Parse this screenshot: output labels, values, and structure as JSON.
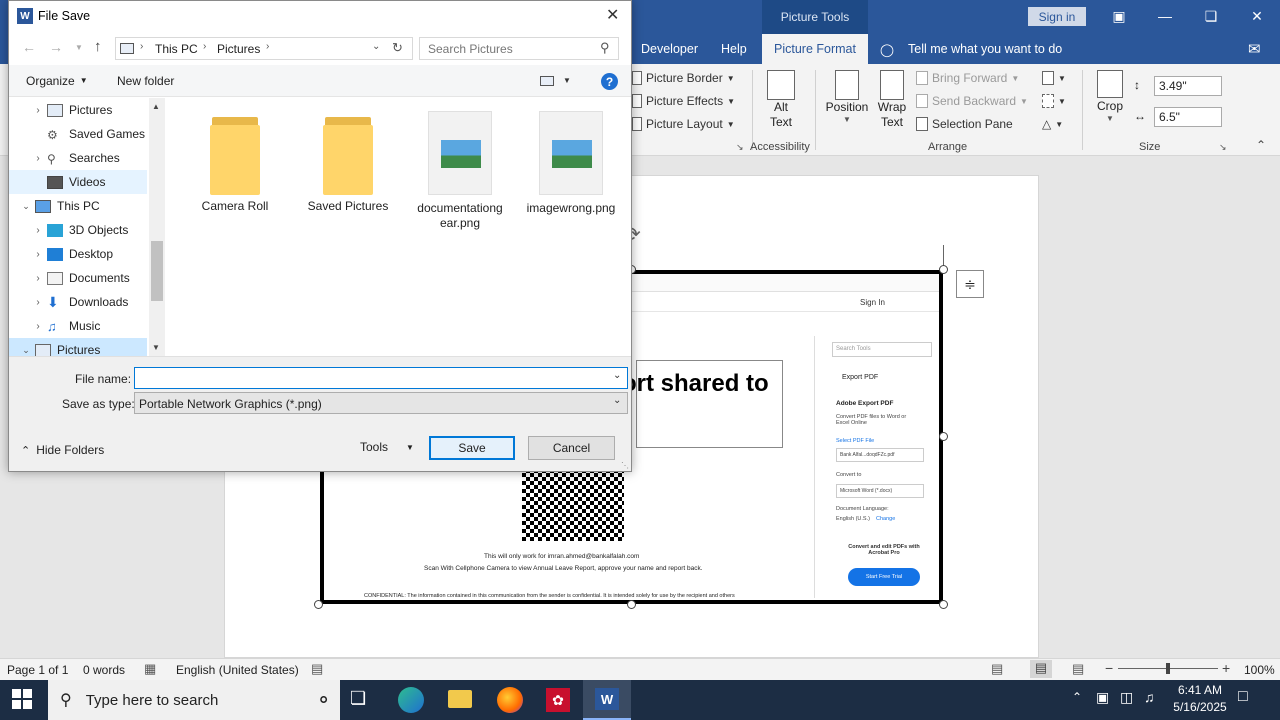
{
  "word": {
    "picture_tools": "Picture Tools",
    "sign_in": "Sign in",
    "tabs": [
      "Developer",
      "Help",
      "Picture Format"
    ],
    "tell_me": "Tell me what you want to do",
    "ribbon": {
      "picture_border": "Picture Border",
      "picture_effects": "Picture Effects",
      "picture_layout": "Picture Layout",
      "alt_text": "Alt Text",
      "accessibility": "Accessibility",
      "position": "Position",
      "wrap_text": "Wrap Text",
      "bring_forward": "Bring Forward",
      "send_backward": "Send Backward",
      "selection_pane": "Selection Pane",
      "arrange": "Arrange",
      "crop": "Crop",
      "height": "3.49\"",
      "width": "6.5\"",
      "size": "Size"
    },
    "status": {
      "page": "Page 1 of 1",
      "words": "0 words",
      "language": "English (United States)",
      "zoom": "100%"
    },
    "embedded": {
      "heading": "ort shared to",
      "line1": "This will only work for imran.ahmed@bankalfalah.com",
      "line2": "Scan With Cellphone Camera to view Annual Leave Report, approve your name and report back.",
      "confidential": "CONFIDENTIAL: The information contained in this communication from the sender is confidential. It is intended solely for use by the recipient and others",
      "sign_in": "Sign In",
      "search_tools": "Search Tools",
      "export_pdf": "Export PDF",
      "adobe_export": "Adobe Export PDF",
      "convert_desc": "Convert PDF files to Word or Excel Online",
      "select_pdf": "Select PDF File",
      "file_name": "Bank Alfal...doqdFZc.pdf",
      "convert_to": "Convert to",
      "format": "Microsoft Word (*.docx)",
      "doc_lang": "Document Language:",
      "lang_value": "English (U.S.)",
      "change": "Change",
      "promo": "Convert and edit PDFs with Acrobat Pro",
      "trial": "Start Free Trial"
    }
  },
  "dialog": {
    "title": "File Save",
    "breadcrumb": [
      "This PC",
      "Pictures"
    ],
    "search_placeholder": "Search Pictures",
    "organize": "Organize",
    "new_folder": "New folder",
    "tree": [
      {
        "label": "Pictures",
        "icon": "pictures-icon"
      },
      {
        "label": "Saved Games",
        "icon": "saved-games-icon"
      },
      {
        "label": "Searches",
        "icon": "searches-icon"
      },
      {
        "label": "Videos",
        "icon": "videos-icon"
      },
      {
        "label": "This PC",
        "icon": "computer-icon"
      },
      {
        "label": "3D Objects",
        "icon": "3d-objects-icon"
      },
      {
        "label": "Desktop",
        "icon": "desktop-icon"
      },
      {
        "label": "Documents",
        "icon": "documents-icon"
      },
      {
        "label": "Downloads",
        "icon": "downloads-icon"
      },
      {
        "label": "Music",
        "icon": "music-icon"
      },
      {
        "label": "Pictures",
        "icon": "pictures-icon"
      }
    ],
    "files": [
      {
        "name": "Camera Roll",
        "type": "folder"
      },
      {
        "name": "Saved Pictures",
        "type": "folder"
      },
      {
        "name": "documentationgear.png",
        "type": "image"
      },
      {
        "name": "imagewrong.png",
        "type": "image"
      }
    ],
    "file_name_label": "File name:",
    "file_name_value": "",
    "save_as_label": "Save as type:",
    "save_as_value": "Portable Network Graphics (*.png)",
    "hide_folders": "Hide Folders",
    "tools": "Tools",
    "save": "Save",
    "cancel": "Cancel"
  },
  "taskbar": {
    "search_placeholder": "Type here to search",
    "time": "6:41 AM",
    "date": "5/16/2025"
  },
  "colors": {
    "word_blue": "#2b579a",
    "accent": "#0078d7"
  }
}
